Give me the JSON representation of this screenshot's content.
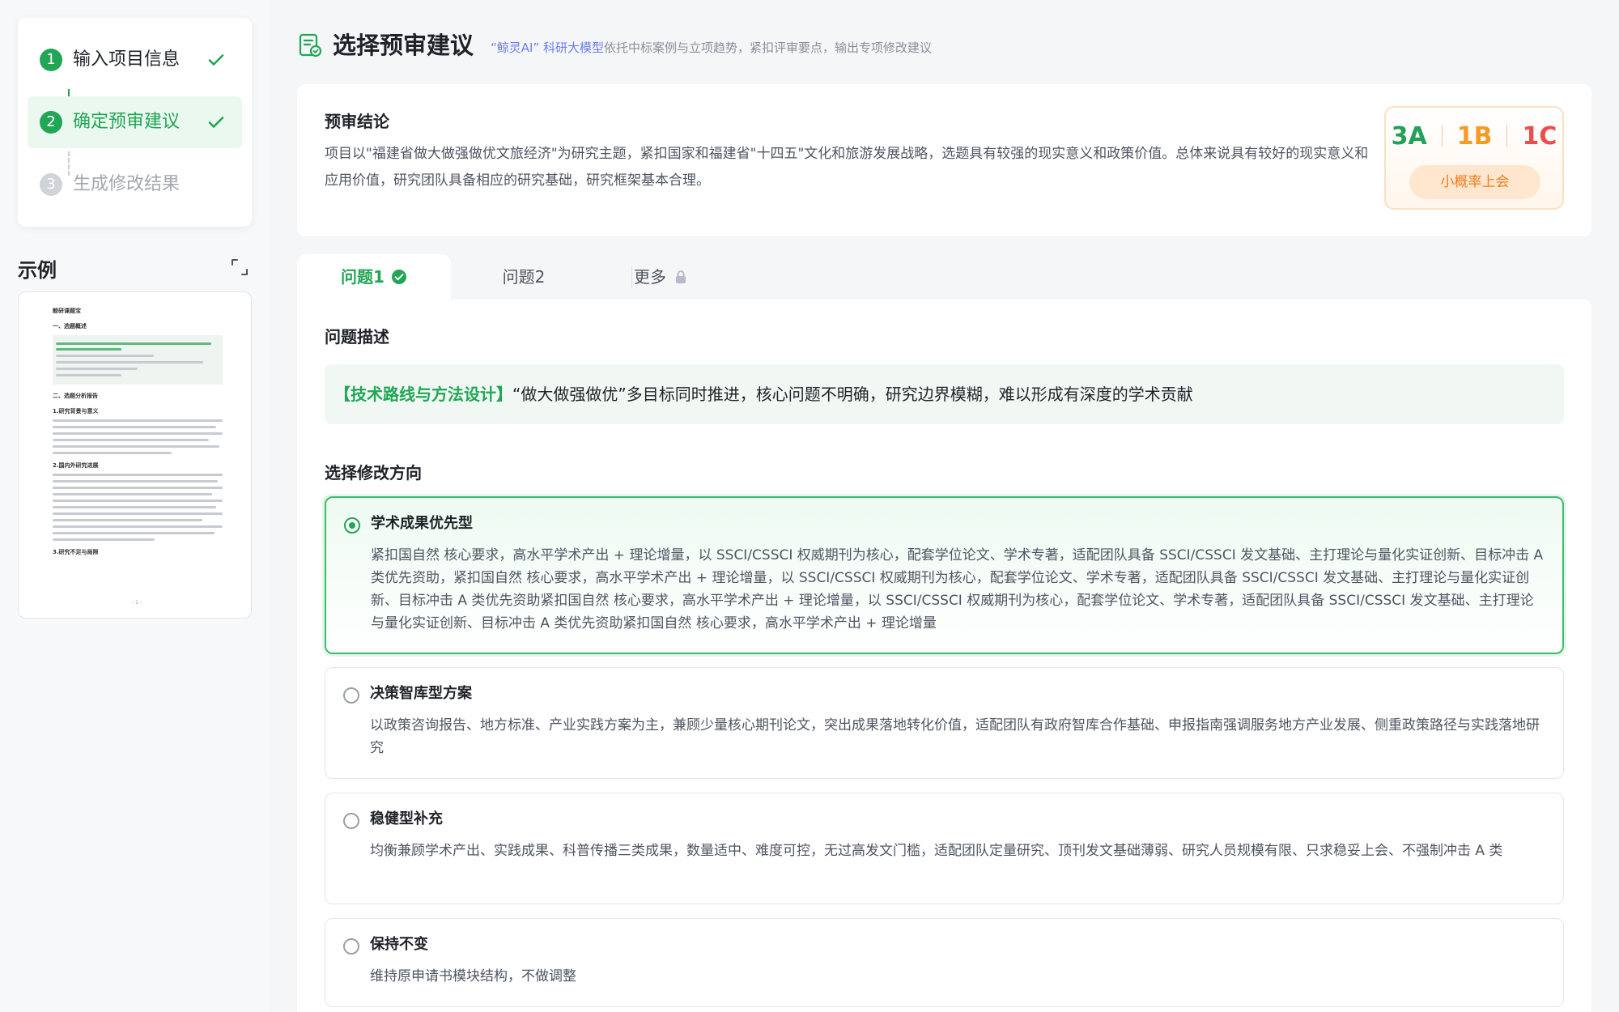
{
  "steps": [
    {
      "num": "1",
      "label": "输入项目信息",
      "state": "done"
    },
    {
      "num": "2",
      "label": "确定预审建议",
      "state": "active"
    },
    {
      "num": "3",
      "label": "生成修改结果",
      "state": "pending"
    }
  ],
  "example": {
    "title": "示例",
    "doc": {
      "logo": "鲸研课题宝",
      "h1": "一、选题概述",
      "h2": "二、选题分析报告",
      "h3": "1.研究背景与意义",
      "h4": "2.国内外研究进展",
      "h5": "3.研究不足与局限",
      "page": "- 1 -"
    }
  },
  "header": {
    "title": "选择预审建议",
    "brand": "“鲸灵AI” 科研大模型",
    "subtitle": "依托中标案例与立项趋势，紧扣评审要点，输出专项修改建议"
  },
  "conclusion": {
    "title": "预审结论",
    "text": "项目以\"福建省做大做强做优文旅经济\"为研究主题，紧扣国家和福建省\"十四五\"文化和旅游发展战略，选题具有较强的现实意义和政策价值。总体来说具有较好的现实意义和应用价值，研究团队具备相应的研究基础，研究框架基本合理。",
    "score_a": "3A",
    "score_b": "1B",
    "score_c": "1C",
    "probability": "小概率上会",
    "colors": {
      "a": "#23a05a",
      "b": "#f59a23",
      "c": "#ef4d4d"
    }
  },
  "tabs": [
    {
      "label": "问题1",
      "icon": "check-circle-icon"
    },
    {
      "label": "问题2"
    },
    {
      "label": "更多",
      "icon": "lock-icon"
    }
  ],
  "issue": {
    "desc_title": "问题描述",
    "tag": "【技术路线与方法设计】",
    "desc": "“做大做强做优”多目标同时推进，核心问题不明确，研究边界模糊，难以形成有深度的学术贡献",
    "direction_title": "选择修改方向"
  },
  "options": [
    {
      "title": "学术成果优先型",
      "selected": true,
      "text": "紧扣国自然 核心要求，高水平学术产出 + 理论增量，以 SSCI/CSSCI 权威期刊为核心，配套学位论文、学术专著，适配团队具备 SSCI/CSSCI 发文基础、主打理论与量化实证创新、目标冲击 A 类优先资助，紧扣国自然 核心要求，高水平学术产出 + 理论增量，以 SSCI/CSSCI 权威期刊为核心，配套学位论文、学术专著，适配团队具备 SSCI/CSSCI 发文基础、主打理论与量化实证创新、目标冲击 A 类优先资助紧扣国自然 核心要求，高水平学术产出 + 理论增量，以 SSCI/CSSCI 权威期刊为核心，配套学位论文、学术专著，适配团队具备 SSCI/CSSCI 发文基础、主打理论与量化实证创新、目标冲击 A 类优先资助紧扣国自然 核心要求，高水平学术产出 + 理论增量"
    },
    {
      "title": "决策智库型方案",
      "selected": false,
      "text": "以政策咨询报告、地方标准、产业实践方案为主，兼顾少量核心期刊论文，突出成果落地转化价值，适配团队有政府智库合作基础、申报指南强调服务地方产业发展、侧重政策路径与实践落地研究"
    },
    {
      "title": "稳健型补充",
      "selected": false,
      "text": "均衡兼顾学术产出、实践成果、科普传播三类成果，数量适中、难度可控，无过高发文门槛，适配团队定量研究、顶刊发文基础薄弱、研究人员规模有限、只求稳妥上会、不强制冲击 A 类"
    },
    {
      "title": "保持不变",
      "selected": false,
      "text": "维持原申请书模块结构，不做调整"
    }
  ]
}
